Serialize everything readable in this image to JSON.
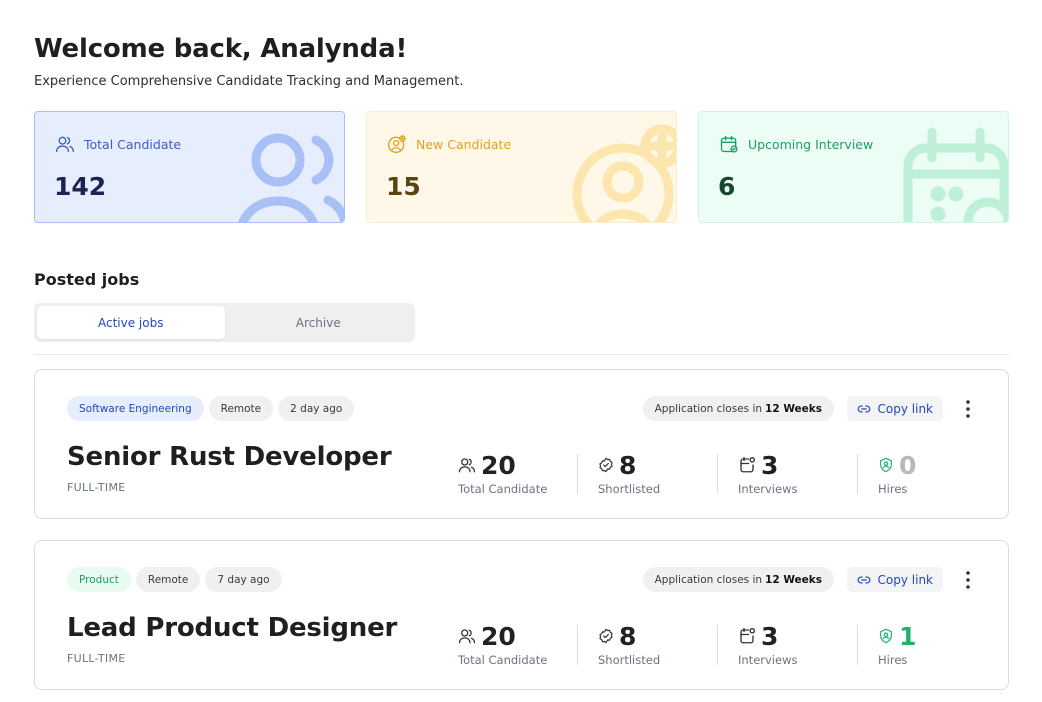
{
  "header": {
    "title": "Welcome back, Analynda!",
    "subtitle": "Experience Comprehensive Candidate Tracking and Management."
  },
  "stats": [
    {
      "label": "Total Candidate",
      "value": "142",
      "icon": "users-icon",
      "color": "#3c5ec9"
    },
    {
      "label": "New Candidate",
      "value": "15",
      "icon": "new-candidate-icon",
      "color": "#e3a21a"
    },
    {
      "label": "Upcoming Interview",
      "value": "6",
      "icon": "calendar-icon",
      "color": "#1f9e63"
    }
  ],
  "jobs_section": {
    "title": "Posted jobs",
    "tabs": [
      {
        "label": "Active jobs",
        "active": true
      },
      {
        "label": "Archive",
        "active": false
      }
    ]
  },
  "jobs": [
    {
      "title": "Senior Rust Developer",
      "type": "FULL-TIME",
      "tags": [
        {
          "label": "Software Engineering",
          "style": "blue"
        },
        {
          "label": "Remote",
          "style": "gray"
        },
        {
          "label": "2 day ago",
          "style": "gray"
        }
      ],
      "closes_prefix": "Application closes in",
      "closes_value": "12 Weeks",
      "copy_link_label": "Copy link",
      "metrics": [
        {
          "value": "20",
          "label": "Total Candidate",
          "icon": "users-icon"
        },
        {
          "value": "8",
          "label": "Shortlisted",
          "icon": "badge-check-icon"
        },
        {
          "value": "3",
          "label": "Interviews",
          "icon": "calendar-icon"
        },
        {
          "value": "0",
          "label": "Hires",
          "icon": "hire-badge-icon"
        }
      ]
    },
    {
      "title": "Lead Product Designer",
      "type": "FULL-TIME",
      "tags": [
        {
          "label": "Product",
          "style": "green"
        },
        {
          "label": "Remote",
          "style": "gray"
        },
        {
          "label": "7 day ago",
          "style": "gray"
        }
      ],
      "closes_prefix": "Application closes in",
      "closes_value": "12 Weeks",
      "copy_link_label": "Copy link",
      "metrics": [
        {
          "value": "20",
          "label": "Total Candidate",
          "icon": "users-icon"
        },
        {
          "value": "8",
          "label": "Shortlisted",
          "icon": "badge-check-icon"
        },
        {
          "value": "3",
          "label": "Interviews",
          "icon": "calendar-icon"
        },
        {
          "value": "1",
          "label": "Hires",
          "icon": "hire-badge-icon"
        }
      ]
    }
  ]
}
